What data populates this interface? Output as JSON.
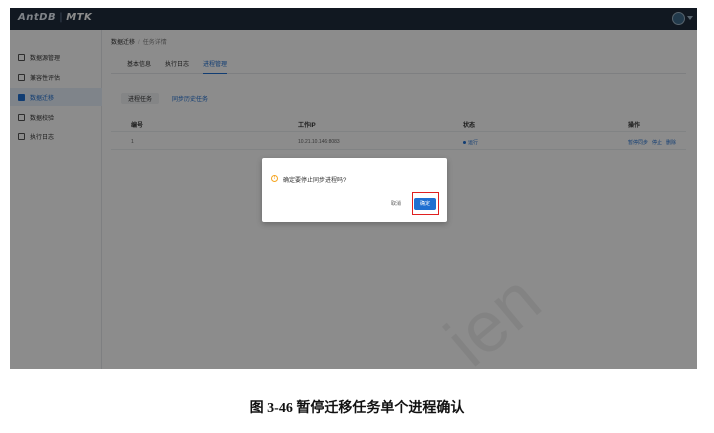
{
  "app": {
    "logo_brand": "AntDB",
    "logo_product": "MTK"
  },
  "sidebar": {
    "items": [
      {
        "label": "数据源管理",
        "icon": "database-icon"
      },
      {
        "label": "兼容性评估",
        "icon": "report-icon"
      },
      {
        "label": "数据迁移",
        "icon": "migrate-icon"
      },
      {
        "label": "数据校验",
        "icon": "check-icon"
      },
      {
        "label": "执行日志",
        "icon": "log-icon"
      }
    ],
    "active_index": 2
  },
  "breadcrumb": {
    "first": "数据迁移",
    "second": "任务详情"
  },
  "tabs": [
    "基本信息",
    "执行日志",
    "进程管理"
  ],
  "active_tab": 2,
  "subtabs": {
    "first": "进程任务",
    "second": "同步历史任务"
  },
  "table": {
    "headers": [
      "编号",
      "工作IP",
      "状态",
      "操作"
    ],
    "rows": [
      {
        "id": "1",
        "ip": "10.21.10.146:8083",
        "status": "运行",
        "ops": [
          "暂停同步",
          "停止",
          "删除"
        ]
      }
    ]
  },
  "dialog": {
    "message": "确定要停止同步进程吗?",
    "cancel_label": "取消",
    "ok_label": "确定"
  },
  "caption": "图 3-46  暂停迁移任务单个进程确认",
  "watermark": "ien"
}
